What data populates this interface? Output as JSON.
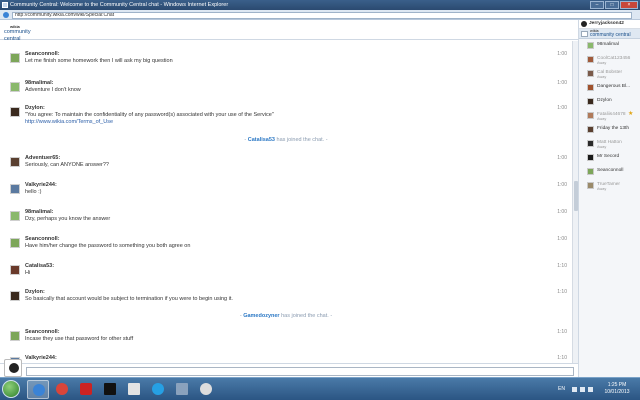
{
  "window": {
    "title": "Community Central: Welcome to the Community Central chat - Windows Internet Explorer",
    "url": "http://community.wikia.com/wiki/Special:Chat"
  },
  "header": {
    "wiki_top": "wikia",
    "wiki_name": "community central"
  },
  "messages": [
    {
      "user": "Seanconnoll:",
      "text": "Let me finish some homework then I will ask my big question",
      "time": "1:00",
      "avatar_color": "#7da65a"
    },
    {
      "user": "98malimal:",
      "text": "Adventure I don't know",
      "time": "1:00",
      "avatar_color": "#8ab86c"
    },
    {
      "user": "Dzylon:",
      "text": "\"You agree: To maintain the confidentiality of any password(s) associated with your use of the Service\"",
      "link": "http://www.wikia.com/Terms_of_Use",
      "time": "1:00",
      "avatar_color": "#3a2a1e"
    },
    {
      "user": "Adventuer65:",
      "text": "Seriously, can ANYONE answer??",
      "time": "1:00",
      "avatar_color": "#5a4030"
    },
    {
      "user": "Valkyrie244:",
      "text": "hello :)",
      "time": "1:00",
      "avatar_color": "#5b7aa0"
    },
    {
      "user": "98malimal:",
      "text": "Dzy, perhaps you know the answer",
      "time": "1:00",
      "avatar_color": "#8ab86c"
    },
    {
      "user": "Seanconnoll:",
      "text": "Have him/her change the password to something you both agree on",
      "time": "1:00",
      "avatar_color": "#7da65a"
    },
    {
      "user": "Catalisa53:",
      "text": "Hi",
      "time": "1:10",
      "avatar_color": "#6a3a2a"
    },
    {
      "user": "Dzylon:",
      "text": "So basically that account would be subject to termination if you were to begin using it.",
      "time": "1:10",
      "avatar_color": "#3a2a1e"
    },
    {
      "user": "Seanconnoll:",
      "text": "Incase they use that password for other stuff",
      "time": "1:10",
      "avatar_color": "#7da65a"
    },
    {
      "user": "Valkyrie244:",
      "text": "",
      "time": "1:10",
      "avatar_color": "#5b7aa0"
    }
  ],
  "alerts": [
    {
      "who": "Catalisa53",
      "rest": " has joined the chat."
    },
    {
      "who": "Gamedozyner",
      "rest": " has joined the chat."
    }
  ],
  "input": {
    "placeholder": ""
  },
  "sidebar": {
    "me": "Jerryjackson42",
    "room_top": "wikia",
    "room_name": "community central",
    "users": [
      {
        "name": "98malimal",
        "status": "",
        "avatar_color": "#8ab86c"
      },
      {
        "name": "CoolCat123456",
        "status": "Away",
        "avatar_color": "#a05a3a"
      },
      {
        "name": "Cal Bobster",
        "status": "Away",
        "avatar_color": "#7a5a4a"
      },
      {
        "name": "Dangerous Bl...",
        "status": "",
        "avatar_color": "#a0522d"
      },
      {
        "name": "Dzylon",
        "status": "",
        "avatar_color": "#3a2a1e"
      },
      {
        "name": "Fataliis44678",
        "status": "Away",
        "avatar_color": "#b07a5a",
        "star": true
      },
      {
        "name": "Friday the 13th",
        "status": "",
        "avatar_color": "#5a4030"
      },
      {
        "name": "Matt Hatton",
        "status": "Away",
        "avatar_color": "#2a2a2a"
      },
      {
        "name": "Mr Secord",
        "status": "",
        "avatar_color": "#1a1a1a"
      },
      {
        "name": "Seanconnoll",
        "status": "",
        "avatar_color": "#7da65a"
      },
      {
        "name": "TrueTamer",
        "status": "Away",
        "avatar_color": "#9a8a6a"
      }
    ]
  },
  "taskbar": {
    "lang": "EN",
    "time": "1:25 PM",
    "date": "10/01/2013"
  }
}
